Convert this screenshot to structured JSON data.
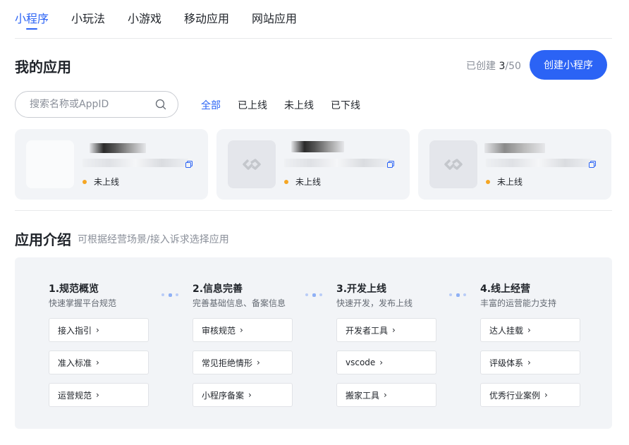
{
  "top_tabs": [
    "小程序",
    "小玩法",
    "小游戏",
    "移动应用",
    "网站应用"
  ],
  "header": {
    "title": "我的应用",
    "created_label": "已创建",
    "created_count": "3",
    "created_total": "/50",
    "create_button": "创建小程序"
  },
  "search": {
    "placeholder": "搜索名称或AppID"
  },
  "filters": [
    "全部",
    "已上线",
    "未上线",
    "已下线"
  ],
  "apps": [
    {
      "status": "未上线",
      "status_color": "#f5a623"
    },
    {
      "status": "未上线",
      "status_color": "#f5a623"
    },
    {
      "status": "未上线",
      "status_color": "#f5a623"
    }
  ],
  "intro": {
    "title": "应用介绍",
    "subtitle": "可根据经营场景/接入诉求选择应用",
    "steps": [
      {
        "title": "1.规范概览",
        "desc": "快速掌握平台规范",
        "links": [
          "接入指引",
          "准入标准",
          "运营规范"
        ]
      },
      {
        "title": "2.信息完善",
        "desc": "完善基础信息、备案信息",
        "links": [
          "审核规范",
          "常见拒绝情形",
          "小程序备案"
        ]
      },
      {
        "title": "3.开发上线",
        "desc": "快速开发，发布上线",
        "links": [
          "开发者工具",
          "vscode",
          "搬家工具"
        ]
      },
      {
        "title": "4.线上经营",
        "desc": "丰富的运营能力支持",
        "links": [
          "达人挂载",
          "评级体系",
          "优秀行业案例"
        ]
      }
    ]
  },
  "colors": {
    "accent": "#2b63f5",
    "status_pending": "#f5a623"
  }
}
